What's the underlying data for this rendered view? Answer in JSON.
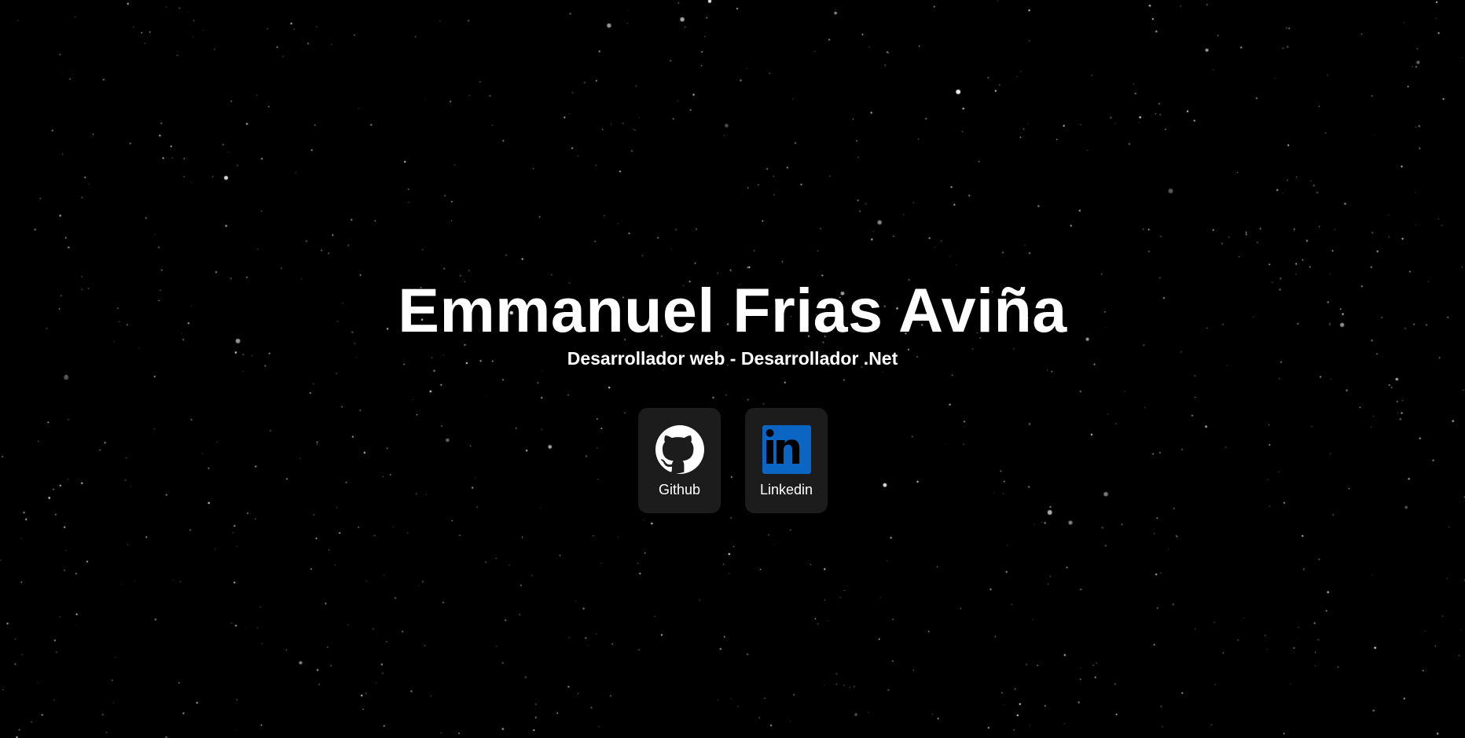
{
  "hero": {
    "name": "Emmanuel Frias Aviña",
    "subtitle": "Desarrollador web - Desarrollador .Net"
  },
  "links": [
    {
      "label": "Github",
      "icon": "github-icon"
    },
    {
      "label": "Linkedin",
      "icon": "linkedin-icon",
      "icon_color": "#0a66c2"
    }
  ],
  "colors": {
    "background": "#000000",
    "card": "#1c1c1c",
    "text": "#ffffff",
    "linkedin": "#0a66c2"
  }
}
